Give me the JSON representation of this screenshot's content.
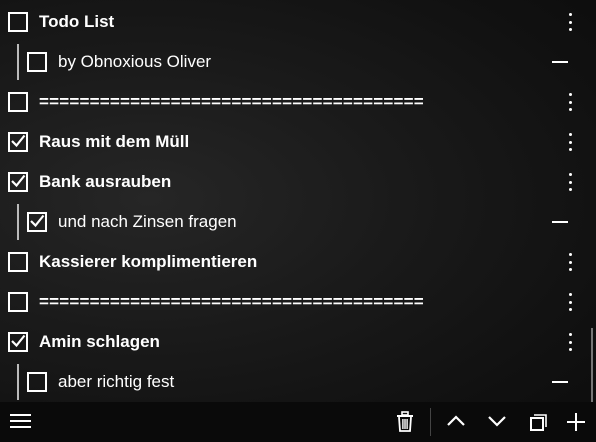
{
  "items": [
    {
      "level": "top",
      "label": "Todo List",
      "checked": false,
      "action": "more-options"
    },
    {
      "level": "sub",
      "label": "by Obnoxious Oliver",
      "checked": false,
      "action": "remove"
    },
    {
      "level": "top",
      "label": "======================================",
      "checked": false,
      "action": "more-options",
      "separator": true
    },
    {
      "level": "top",
      "label": "Raus mit dem Müll",
      "checked": true,
      "action": "more-options"
    },
    {
      "level": "top",
      "label": "Bank ausrauben",
      "checked": true,
      "action": "more-options"
    },
    {
      "level": "sub",
      "label": "und nach Zinsen fragen",
      "checked": true,
      "action": "remove"
    },
    {
      "level": "top",
      "label": "Kassierer komplimentieren",
      "checked": false,
      "action": "more-options"
    },
    {
      "level": "top",
      "label": "======================================",
      "checked": false,
      "action": "more-options",
      "separator": true
    },
    {
      "level": "top",
      "label": "Amin schlagen",
      "checked": true,
      "action": "more-options"
    },
    {
      "level": "sub",
      "label": "aber richtig fest",
      "checked": false,
      "action": "remove"
    }
  ],
  "toolbar": {
    "icons": [
      "hamburger-menu-icon",
      "trash-icon",
      "chevron-up-icon",
      "chevron-down-icon",
      "restore-window-icon",
      "plus-icon"
    ]
  },
  "colors": {
    "background": "#1a1a1a",
    "foreground": "#ffffff",
    "toolbar": "#0a0a0a"
  }
}
